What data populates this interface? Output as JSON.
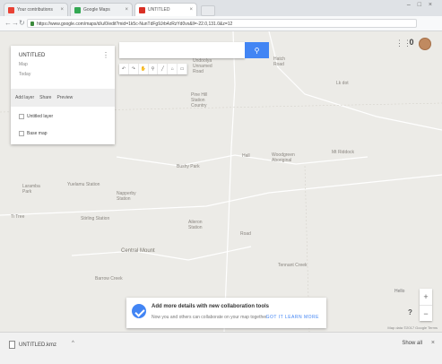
{
  "browser": {
    "tabs": [
      {
        "label": "Your contributions",
        "color": "#e94235"
      },
      {
        "label": "Google Maps",
        "color": "#34a853"
      },
      {
        "label": "UNTITLED",
        "color": "#d93025"
      }
    ],
    "url": "https://www.google.com/maps/d/u/0/edit?mid=1k5c-NunTdFg9Jrb4zRzYd0vx&ll=-22.0,131.0&z=12"
  },
  "panel": {
    "title": "UNTITLED",
    "subtitle": "Map",
    "description": "Today",
    "actions": [
      "Add layer",
      "Share",
      "Preview"
    ],
    "layers": [
      "Untitled layer",
      "Base map"
    ]
  },
  "search": {
    "placeholder": ""
  },
  "toolbar": {
    "tools": [
      "↶",
      "↷",
      "✋",
      "⚲",
      "╱",
      "⌂",
      "▭"
    ]
  },
  "map_places": [
    {
      "text": "Undoolya\nUnnamed\nRoad",
      "id": "p1"
    },
    {
      "text": "Hatch\nRoad",
      "id": "p2"
    },
    {
      "text": "Lk dot",
      "id": "p3"
    },
    {
      "text": "Pine Hill\nStation\nCountry",
      "id": "p4"
    },
    {
      "text": "Bushy Park",
      "id": "p5"
    },
    {
      "text": "Hall",
      "id": "p6"
    },
    {
      "text": "Woodgreen\nAboriginal",
      "id": "p7"
    },
    {
      "text": "Mt Riddock",
      "id": "p8"
    },
    {
      "text": "Laramba\nPark",
      "id": "p9"
    },
    {
      "text": "Yuelamu Station",
      "id": "p10"
    },
    {
      "text": "Napperby\nStation",
      "id": "p11"
    },
    {
      "text": "Ti Tree",
      "id": "p12"
    },
    {
      "text": "Stirling Station",
      "id": "p13"
    },
    {
      "text": "Aileron\nStation",
      "id": "p14"
    },
    {
      "text": "Road",
      "id": "p15"
    },
    {
      "text": "Central Mount",
      "id": "p16"
    },
    {
      "text": "Tennant Creek",
      "id": "p17"
    },
    {
      "text": "Barrow Creek",
      "id": "p18"
    }
  ],
  "controls": {
    "zoom_in": "+",
    "zoom_out": "−",
    "help": "?",
    "location_label": "Hello"
  },
  "banner": {
    "heading": "Add more details with new collaboration tools",
    "text": "Now you and others can collaborate on your map together",
    "links": "GOT IT   LEARN MORE"
  },
  "attribution": "Map data ©2017 Google   Terms",
  "downloads": {
    "file": "UNTITLED.kmz",
    "caret": "^",
    "show_all": "Show all",
    "close": "×"
  },
  "icons": {
    "apps": "grid-icon",
    "notifications": "bell-icon",
    "avatar": "user-avatar"
  },
  "colors": {
    "accent": "#4285f4",
    "map_bg": "#ecebe7"
  }
}
